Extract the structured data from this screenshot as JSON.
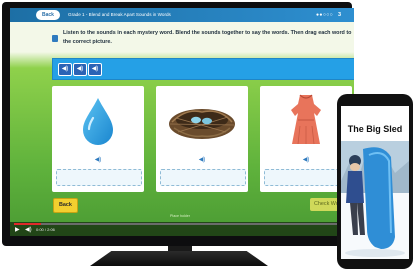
{
  "lesson": {
    "back_pill": "Back",
    "title": "Grade 1 - Blend and Break Apart Sounds in Words",
    "progress_dots": "●●○○○",
    "progress_number": "3",
    "instructions": "Listen to the sounds in each mystery word. Blend the sounds together to say the words. Then drag each word to the correct picture.",
    "audio_buttons": [
      "◀)",
      "◀)",
      "◀)"
    ],
    "cards": [
      {
        "picture": "water-drop"
      },
      {
        "picture": "bird-nest"
      },
      {
        "picture": "dress"
      }
    ],
    "speaker_glyph": "◀)",
    "back_button": "Back",
    "check_button": "Check Wo",
    "footer": "Place holder"
  },
  "player": {
    "time": "0:00 / 2:06",
    "progress_fraction": 0.08
  },
  "phone": {
    "book_title": "The Big Sled"
  },
  "colors": {
    "top_bar": "#1d6fa5",
    "audio_bar": "#25a0e6",
    "back_button": "#f3cf2f",
    "lesson_green": "#5fb23c"
  }
}
